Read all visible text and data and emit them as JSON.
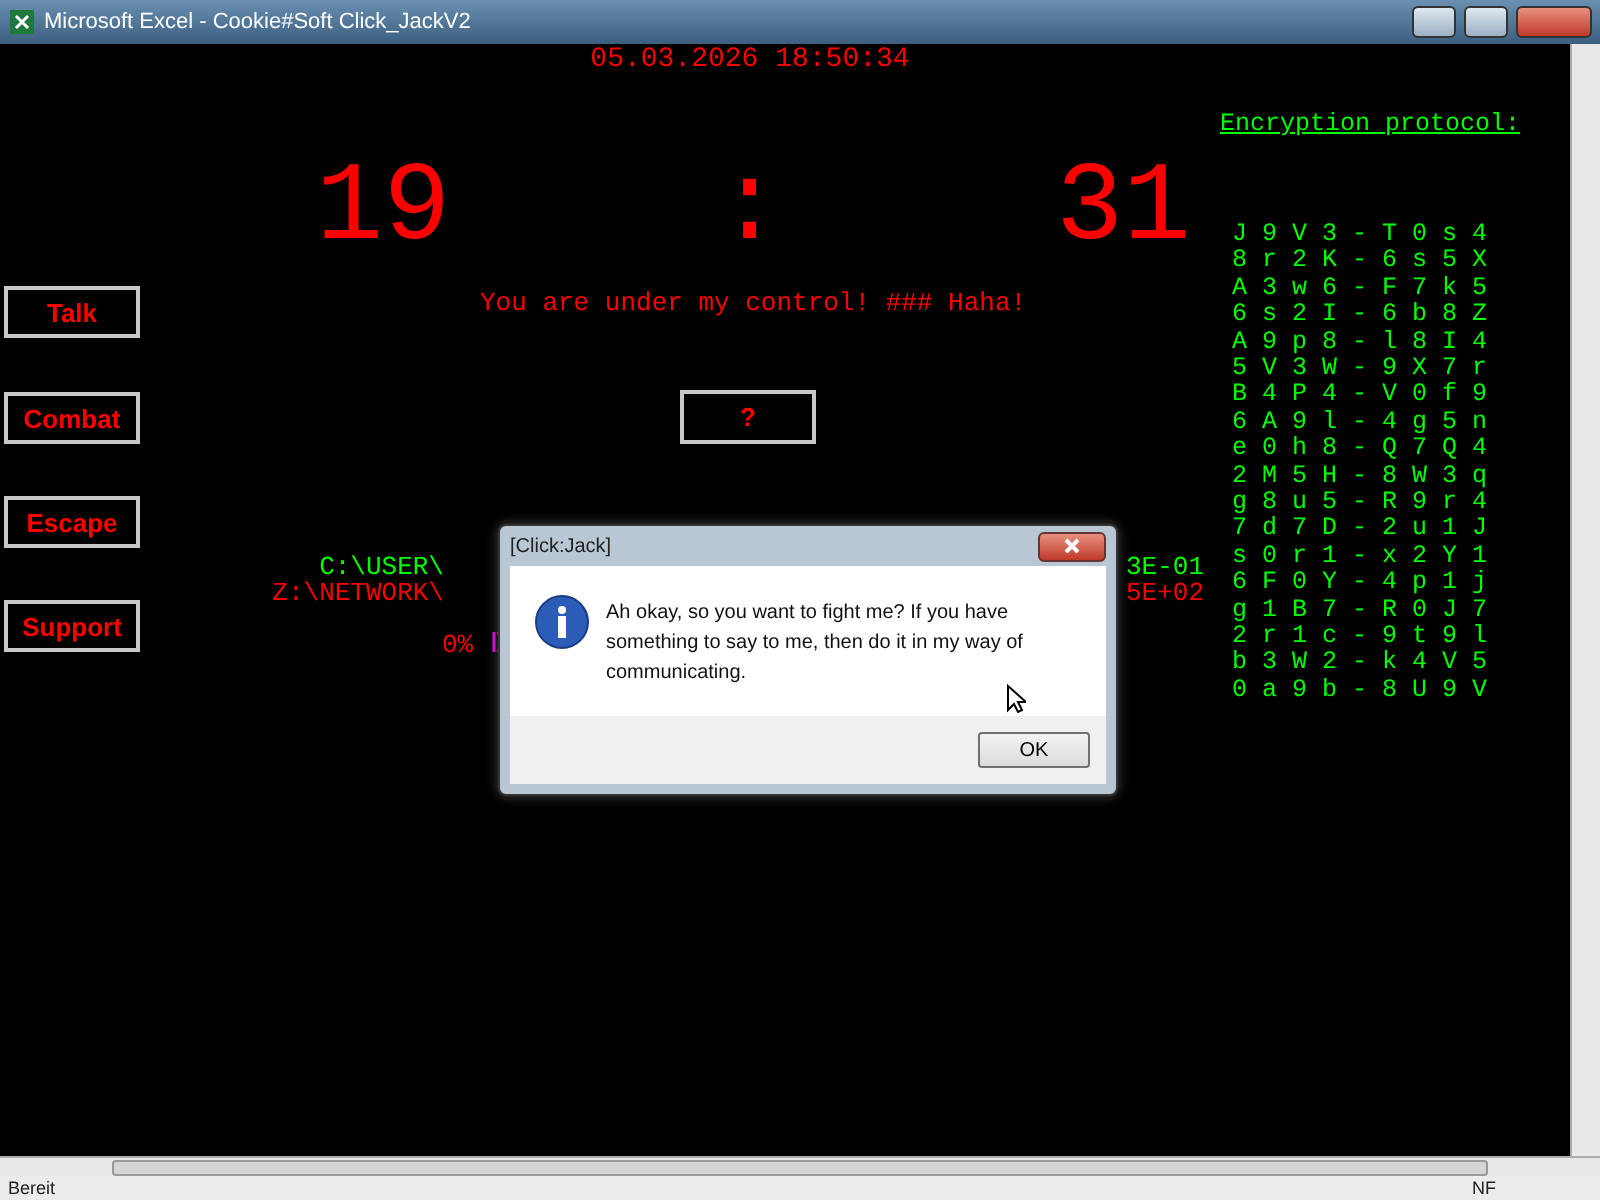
{
  "window": {
    "title": "Microsoft Excel - Cookie#Soft Click_JackV2"
  },
  "sheet": {
    "datetime": "05.03.2026 18:50:34",
    "timer": {
      "minutes": "19",
      "separator": ":",
      "seconds": "31"
    },
    "message": "You are under my control! ### Haha!",
    "question_box": "?",
    "side_buttons": [
      "Talk",
      "Combat",
      "Escape",
      "Support"
    ],
    "paths": [
      {
        "text": "C:\\USER\\",
        "color": "#00ff00"
      },
      {
        "text": "Z:\\NETWORK\\",
        "color": "#ff0000"
      }
    ],
    "values": [
      {
        "text": "3E-01",
        "color": "#00ff00"
      },
      {
        "text": "5E+02",
        "color": "#ff0000"
      }
    ],
    "progress": "0%",
    "encryption": {
      "title": "Encryption protocol:",
      "rows": [
        "J 9 V 3 - T 0 s 4",
        "8 r 2 K - 6 s 5 X",
        "A 3 w 6 - F 7 k 5",
        "6 s 2 I - 6 b 8 Z",
        "A 9 p 8 - l 8 I 4",
        "5 V 3 W - 9 X 7 r",
        "B 4 P 4 - V 0 f 9",
        "6 A 9 l - 4 g 5 n",
        "e 0 h 8 - Q 7 Q 4",
        "2 M 5 H - 8 W 3 q",
        "g 8 u 5 - R 9 r 4",
        "7 d 7 D - 2 u 1 J",
        "s 0 r 1 - x 2 Y 1",
        "6 F 0 Y - 4 p 1 j",
        "g 1 B 7 - R 0 J 7",
        "2 r 1 c - 9 t 9 l",
        "b 3 W 2 - k 4 V 5",
        "0 a 9 b - 8 U 9 V"
      ]
    }
  },
  "dialog": {
    "title": "[Click:Jack]",
    "message": "Ah okay, so you want to fight me? If you have something to say to me, then do it in my way of communicating.",
    "button": "OK"
  },
  "status_bar": {
    "left": "Bereit",
    "indicator": "NF"
  }
}
